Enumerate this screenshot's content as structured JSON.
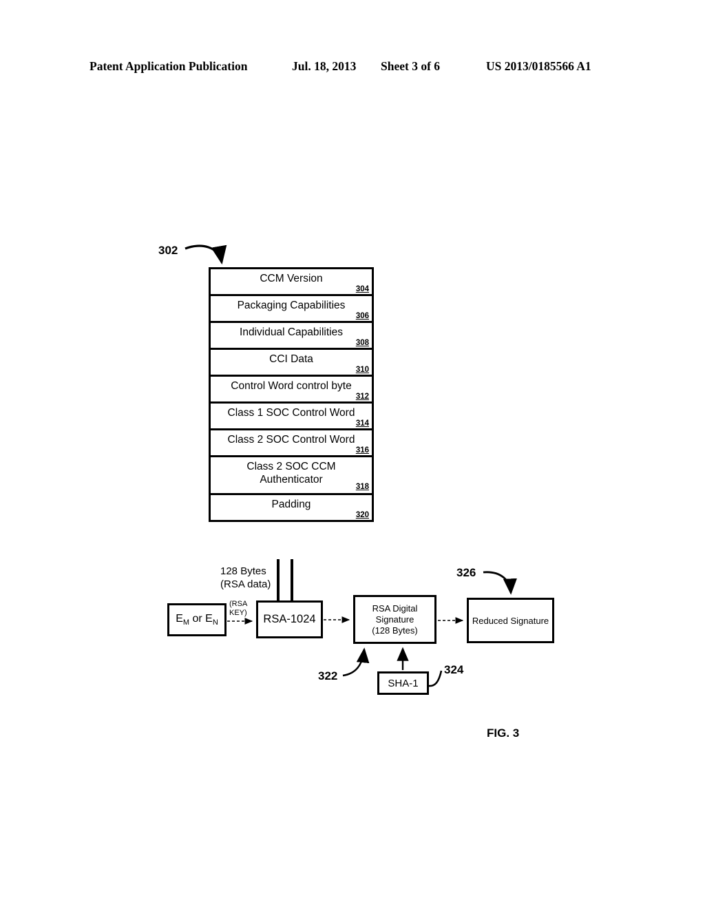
{
  "header": {
    "publication": "Patent Application Publication",
    "date": "Jul. 18, 2013",
    "sheet": "Sheet 3 of 6",
    "patent_number": "US 2013/0185566 A1"
  },
  "figure": {
    "caption": "FIG. 3",
    "stack_ref": "302",
    "stack": {
      "rows": [
        {
          "label": "CCM Version",
          "ref": "304"
        },
        {
          "label": "Packaging Capabilities",
          "ref": "306"
        },
        {
          "label": "Individual Capabilities",
          "ref": "308"
        },
        {
          "label": "CCI Data",
          "ref": "310"
        },
        {
          "label": "Control Word control byte",
          "ref": "312"
        },
        {
          "label": "Class 1 SOC Control Word",
          "ref": "314"
        },
        {
          "label": "Class 2 SOC Control Word",
          "ref": "316"
        },
        {
          "label": "Class 2 SOC CCM\nAuthenticator",
          "ref": "318"
        },
        {
          "label": "Padding",
          "ref": "320"
        }
      ]
    },
    "annotations": {
      "data_size_line1": "128 Bytes",
      "data_size_line2": "(RSA data)",
      "rsa_key_line1": "(RSA",
      "rsa_key_line2": "KEY)"
    },
    "flow": {
      "key_box": {
        "text_pre": "E",
        "text_sub1": "M",
        "text_mid": " or E",
        "text_sub2": "N"
      },
      "rsa_box": {
        "label": "RSA-1024"
      },
      "signature_box": {
        "line1": "RSA Digital",
        "line2": "Signature",
        "line3": "(128 Bytes)",
        "ref": "322"
      },
      "sha_box": {
        "label": "SHA-1",
        "ref": "324"
      },
      "reduced_box": {
        "label": "Reduced Signature",
        "ref": "326"
      }
    }
  },
  "colors": {
    "ink": "#000000",
    "page": "#ffffff"
  }
}
